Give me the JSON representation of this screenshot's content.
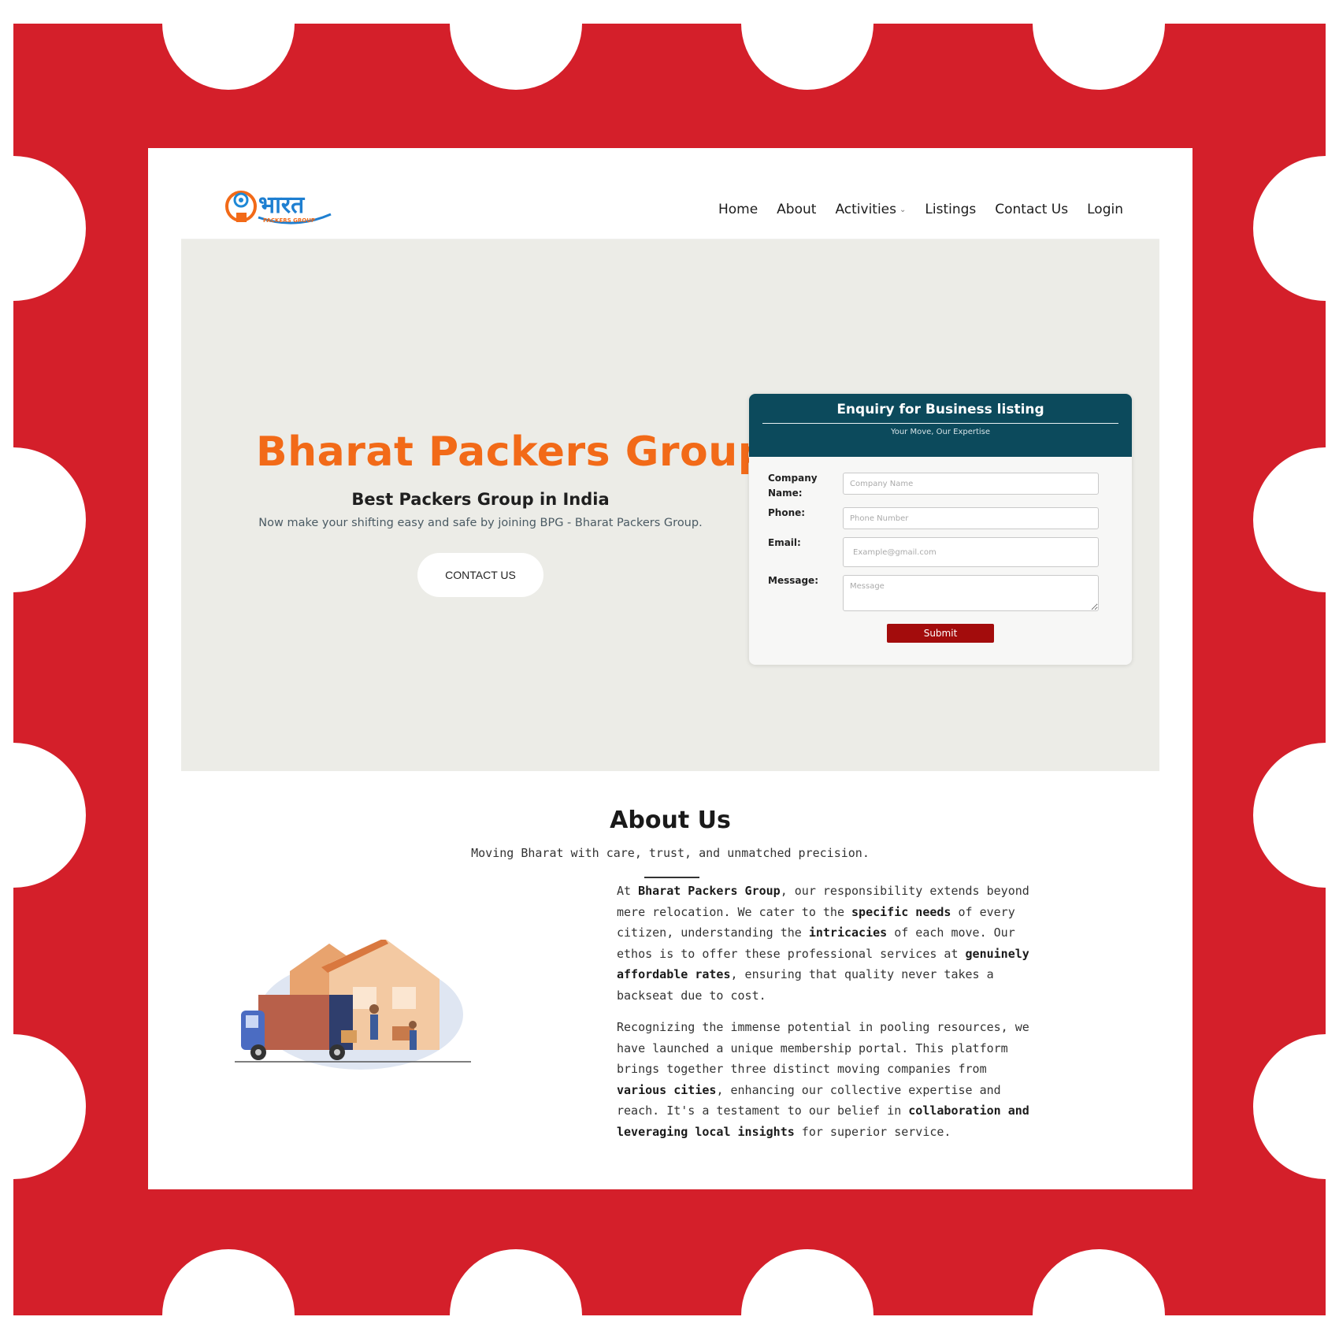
{
  "brand": {
    "logo_text": "भारत",
    "logo_small_text": "PACKERS GROUP",
    "orange": "#f26a18",
    "teal": "#0c4a5c",
    "submit_red": "#a30c0c",
    "frame_red": "#d41f2a"
  },
  "nav": {
    "home": "Home",
    "about": "About",
    "activities": "Activities",
    "listings": "Listings",
    "contact": "Contact Us",
    "login": "Login"
  },
  "hero": {
    "title": "Bharat Packers Group",
    "subtitle": "Best Packers Group in India",
    "description": "Now make your shifting easy and safe by joining BPG - Bharat Packers Group.",
    "cta": "CONTACT US"
  },
  "form": {
    "title": "Enquiry for Business listing",
    "tagline": "Your Move, Our Expertise",
    "company_label_1": "Company",
    "company_label_2": "Name:",
    "company_placeholder": "Company Name",
    "phone_label": "Phone:",
    "phone_placeholder": "Phone Number",
    "email_label": "Email:",
    "email_placeholder": "Example@gmail.com",
    "message_label": "Message:",
    "message_placeholder": "Message",
    "submit": "Submit"
  },
  "about": {
    "title": "About Us",
    "subtitle": "Moving Bharat with care, trust, and unmatched precision.",
    "p1": {
      "t1": "At ",
      "b1": "Bharat Packers Group",
      "t2": ", our responsibility extends beyond mere relocation. We cater to the ",
      "b2": "specific needs",
      "t3": " of every citizen, understanding the ",
      "b3": "intricacies",
      "t4": " of each move. Our ethos is to offer these professional services at ",
      "b4": "genuinely affordable rates",
      "t5": ", ensuring that quality never takes a backseat due to cost."
    },
    "p2": {
      "t1": "Recognizing the immense potential in pooling resources, we have launched a unique membership portal. This platform brings together three distinct moving companies from ",
      "b1": "various cities",
      "t2": ", enhancing our collective expertise and reach. It's a testament to our belief in ",
      "b2": "collaboration and leveraging local insights",
      "t3": " for superior service."
    }
  }
}
